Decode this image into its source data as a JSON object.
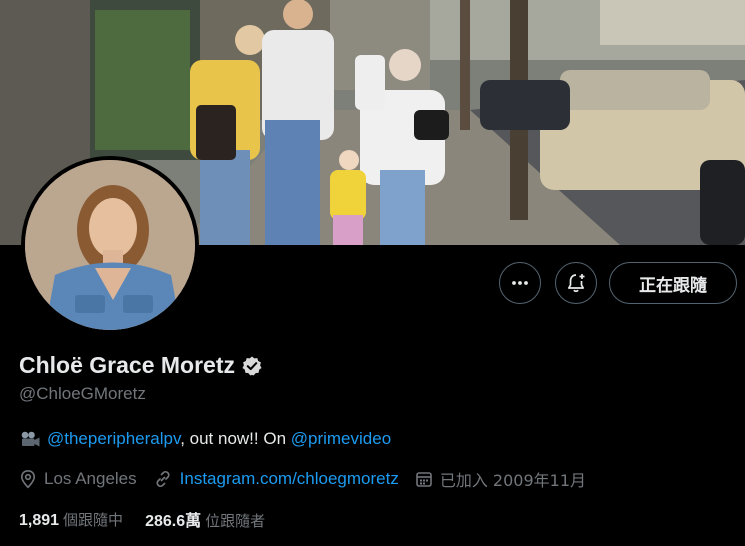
{
  "profile": {
    "display_name": "Chloë Grace Moretz",
    "handle": "@ChloeGMoretz",
    "verified_badge_icon": "verified-badge-icon",
    "bio": {
      "emoji_icon": "movie-camera-icon",
      "mention_1": "@theperipheralpv",
      "text_1": ", out now!! On ",
      "mention_2": "@primevideo"
    },
    "location": "Los Angeles",
    "website": "Instagram.com/chloegmoretz",
    "joined": "已加入 2009年11月",
    "following_count": "1,891",
    "following_label": "個跟隨中",
    "followers_count": "286.6萬",
    "followers_label": "位跟隨者"
  },
  "actions": {
    "more_icon": "more-icon",
    "notify_icon": "bell-plus-icon",
    "following_label": "正在跟隨"
  },
  "colors": {
    "background": "#000000",
    "text_primary": "#e7e9ea",
    "text_secondary": "#71767b",
    "accent": "#1d9bf0"
  }
}
